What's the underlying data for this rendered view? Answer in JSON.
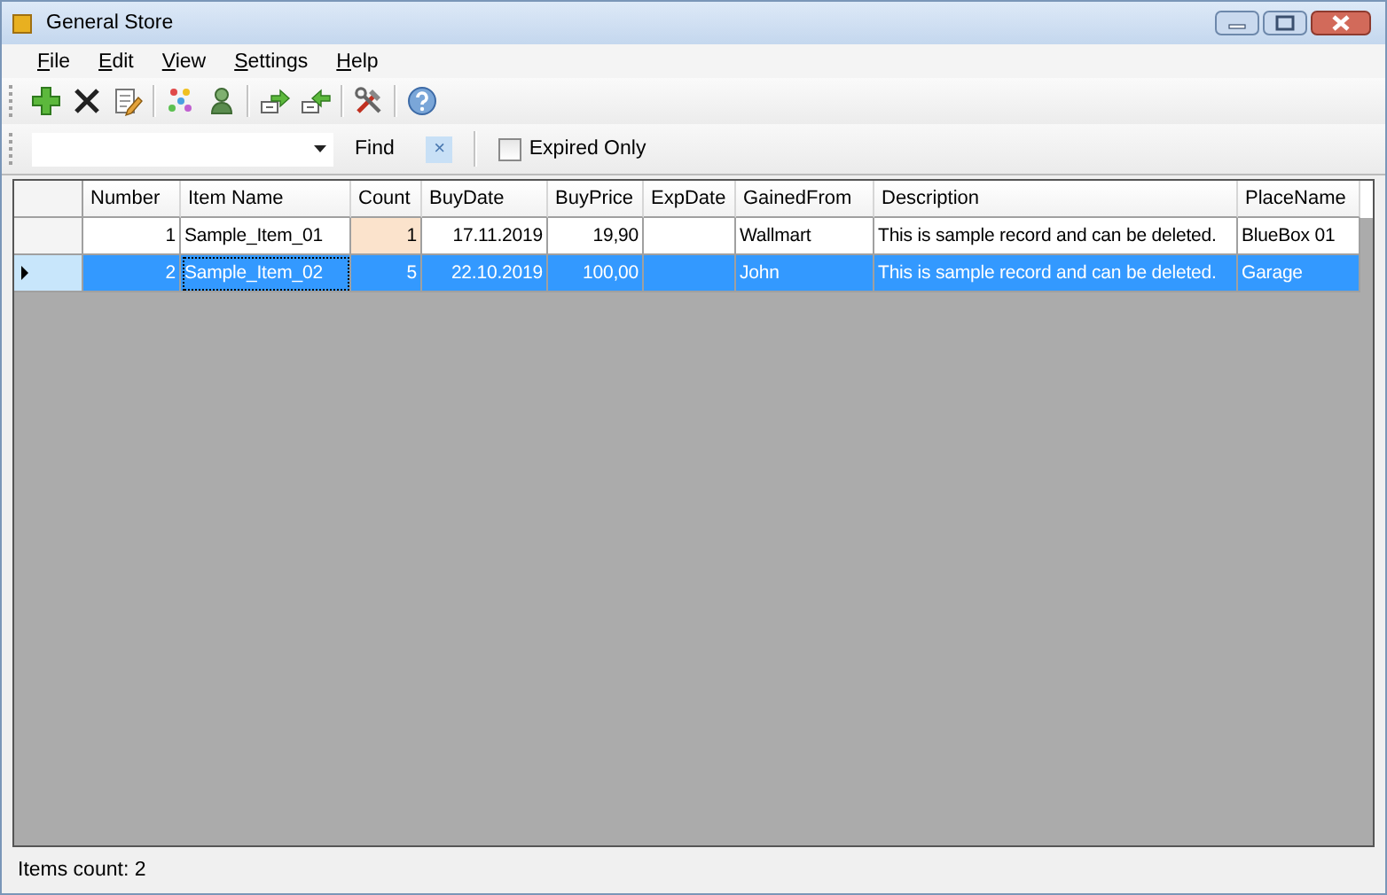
{
  "window": {
    "title": "General Store"
  },
  "menu": [
    {
      "label": "File"
    },
    {
      "label": "Edit"
    },
    {
      "label": "View"
    },
    {
      "label": "Settings"
    },
    {
      "label": "Help"
    }
  ],
  "toolbar": [
    {
      "kind": "add"
    },
    {
      "kind": "delete"
    },
    {
      "kind": "edit"
    },
    {
      "kind": "separator"
    },
    {
      "kind": "dots"
    },
    {
      "kind": "person"
    },
    {
      "kind": "separator"
    },
    {
      "kind": "export"
    },
    {
      "kind": "import"
    },
    {
      "kind": "separator"
    },
    {
      "kind": "tools"
    },
    {
      "kind": "separator"
    },
    {
      "kind": "help"
    }
  ],
  "find_bar": {
    "find_label": "Find",
    "clear": "×",
    "expired_only": {
      "label": "Expired Only",
      "checked": false
    }
  },
  "table": {
    "columns": [
      {
        "label": "Number",
        "numeric": true
      },
      {
        "label": "Item Name",
        "numeric": false
      },
      {
        "label": "Count",
        "numeric": true
      },
      {
        "label": "BuyDate",
        "numeric": true
      },
      {
        "label": "BuyPrice",
        "numeric": true
      },
      {
        "label": "ExpDate"
      },
      {
        "label": "GainedFrom",
        "numeric": false
      },
      {
        "label": "Description",
        "numeric": false
      },
      {
        "label": "PlaceName",
        "numeric": false
      }
    ],
    "rows": [
      {
        "selected": false,
        "current": false,
        "cells": [
          {
            "text": "1",
            "focused": false,
            "highlighted": false
          },
          {
            "text": "Sample_Item_01",
            "focused": false,
            "highlighted": false
          },
          {
            "text": "1",
            "focused": false,
            "highlighted": true
          },
          {
            "text": "17.11.2019",
            "focused": false,
            "highlighted": false
          },
          {
            "text": "19,90",
            "focused": false,
            "highlighted": false
          },
          {
            "focused": false,
            "highlighted": false
          },
          {
            "text": "Wallmart",
            "focused": false,
            "highlighted": false
          },
          {
            "text": "This is sample record and can be deleted.",
            "focused": false,
            "highlighted": false
          },
          {
            "text": "BlueBox 01",
            "focused": false,
            "highlighted": false
          }
        ]
      },
      {
        "selected": true,
        "current": true,
        "cells": [
          {
            "text": "2",
            "focused": false,
            "highlighted": false
          },
          {
            "text": "Sample_Item_02",
            "focused": true,
            "highlighted": false
          },
          {
            "text": "5",
            "focused": false,
            "highlighted": false
          },
          {
            "text": "22.10.2019",
            "focused": false,
            "highlighted": false
          },
          {
            "text": "100,00",
            "focused": false,
            "highlighted": false
          },
          {
            "focused": false,
            "highlighted": false
          },
          {
            "text": "John",
            "focused": false,
            "highlighted": false
          },
          {
            "text": "This is sample record and can be deleted.",
            "focused": false,
            "highlighted": false
          },
          {
            "text": "Garage",
            "focused": false,
            "highlighted": false
          }
        ]
      }
    ]
  },
  "status_bar": {
    "text": "Items count: 2"
  }
}
